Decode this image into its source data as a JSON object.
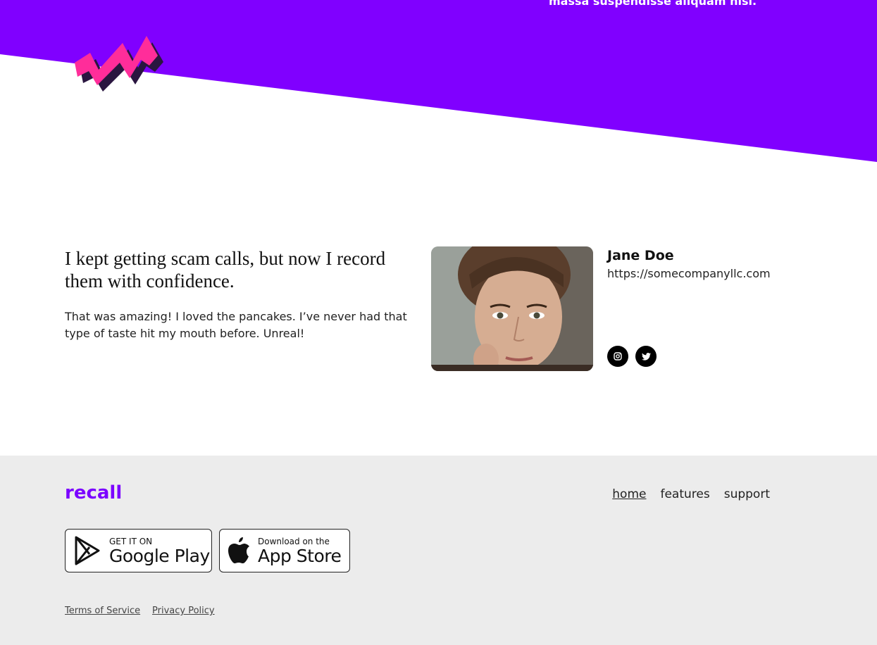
{
  "hero": {
    "overflow_text": "massa suspendisse aliquam nisi.",
    "bg_color": "#8000ff",
    "zigzag_color": "#ff2d9a"
  },
  "testimonial": {
    "quote": "I kept getting scam calls, but now I record them with confidence.",
    "body": "That was amazing! I loved the pancakes. I’ve never had that type of taste hit my mouth before. Unreal!",
    "name": "Jane Doe",
    "url": "https://somecompanyllc.com",
    "photo_icon": "portrait-photo",
    "social": [
      {
        "icon": "instagram-icon"
      },
      {
        "icon": "twitter-icon"
      }
    ]
  },
  "footer": {
    "logo": "recall",
    "logo_color": "#7b00ff",
    "nav": [
      {
        "label": "home",
        "active": true
      },
      {
        "label": "features",
        "active": false
      },
      {
        "label": "support",
        "active": false
      }
    ],
    "google_play": {
      "small": "GET IT ON",
      "big": "Google Play",
      "icon": "google-play-icon"
    },
    "app_store": {
      "small": "Download on the",
      "big": "App Store",
      "icon": "apple-icon"
    },
    "terms": "Terms of Service",
    "privacy": "Privacy Policy"
  }
}
